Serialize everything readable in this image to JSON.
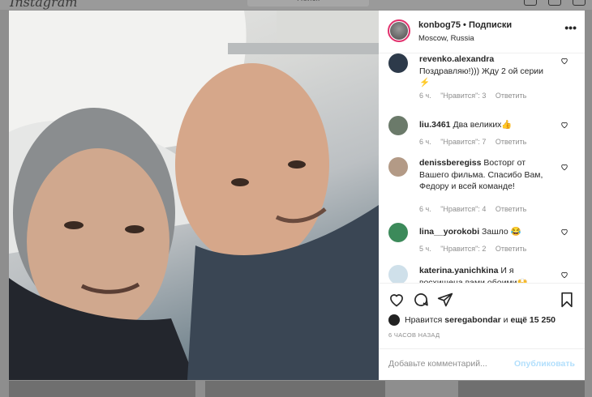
{
  "app": {
    "logo": "Instagram",
    "search_placeholder": "Поиск"
  },
  "post": {
    "username": "konbog75",
    "follow_label": "Подписки",
    "separator": "•",
    "location": "Moscow, Russia",
    "more_label": "•••"
  },
  "comments": [
    {
      "user": "revenko.alexandra",
      "text": "Поздравляю!))) Жду 2 ой серии ⚡",
      "time": "6 ч.",
      "likes": "\"Нравится\": 3",
      "reply": "Ответить",
      "avatar_color": "#2d3a4a"
    },
    {
      "user": "liu.3461",
      "text": "Два великих👍",
      "time": "6 ч.",
      "likes": "\"Нравится\": 7",
      "reply": "Ответить",
      "avatar_color": "#6b7a6a"
    },
    {
      "user": "denissberegiss",
      "text": "Восторг от Вашего фильма. Спасибо Вам, Федору и всей команде!",
      "time": "6 ч.",
      "likes": "\"Нравится\": 4",
      "reply": "Ответить",
      "avatar_color": "#b39a86"
    },
    {
      "user": "lina__yorokobi",
      "text": "Зашло 😂",
      "time": "5 ч.",
      "likes": "\"Нравится\": 2",
      "reply": "Ответить",
      "avatar_color": "#3c8a5a"
    },
    {
      "user": "katerina.yanichkina",
      "text": "И я восхищена вами обоими🙌",
      "time": "",
      "likes": "",
      "reply": "",
      "avatar_color": "#cfe0ea"
    }
  ],
  "likes": {
    "prefix": "Нравится",
    "user": "seregabondar",
    "middle": "и",
    "count": "ещё 15 250"
  },
  "timestamp": "6 ЧАСОВ НАЗАД",
  "add_comment": {
    "placeholder": "Добавьте комментарий...",
    "post_label": "Опубликовать"
  },
  "colors": {
    "link_disabled": "#b2dffc",
    "story_ring": "#e1306c"
  }
}
